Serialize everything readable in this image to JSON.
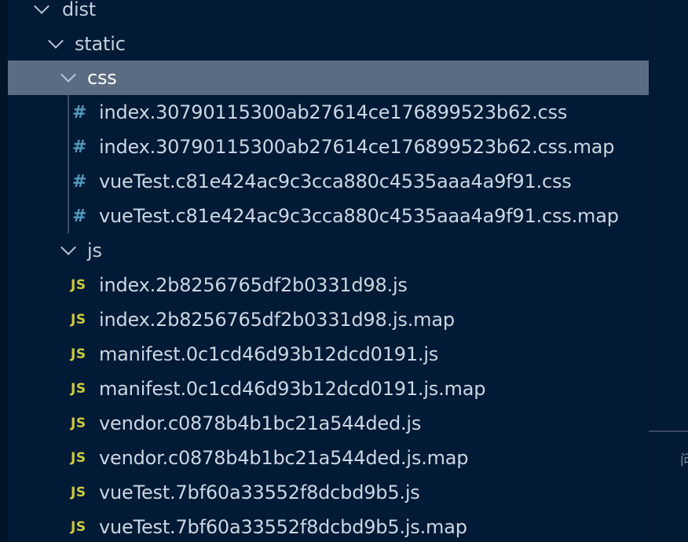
{
  "explorer": {
    "folders": {
      "dist": "dist",
      "static": "static",
      "css": "css",
      "js": "js"
    },
    "css_icon": "#",
    "js_icon": "JS",
    "css_files": [
      "index.30790115300ab27614ce176899523b62.css",
      "index.30790115300ab27614ce176899523b62.css.map",
      "vueTest.c81e424ac9c3cca880c4535aaa4a9f91.css",
      "vueTest.c81e424ac9c3cca880c4535aaa4a9f91.css.map"
    ],
    "js_files": [
      "index.2b8256765df2b0331d98.js",
      "index.2b8256765df2b0331d98.js.map",
      "manifest.0c1cd46d93b12dcd0191.js",
      "manifest.0c1cd46d93b12dcd0191.js.map",
      "vendor.c0878b4b1bc21a544ded.js",
      "vendor.c0878b4b1bc21a544ded.js.map",
      "vueTest.7bf60a33552f8dcbd9b5.js",
      "vueTest.7bf60a33552f8dcbd9b5.js.map"
    ]
  },
  "right_pane": {
    "glyph": "问"
  },
  "colors": {
    "background": "#011a36",
    "selection": "#5b6b82",
    "css_icon": "#519aba",
    "js_icon": "#cbcb41",
    "text": "#cbd6e2"
  },
  "icons": {
    "folder_expanded": "chevron-down-icon",
    "css_file": "css-file-icon",
    "js_file": "js-file-icon"
  }
}
